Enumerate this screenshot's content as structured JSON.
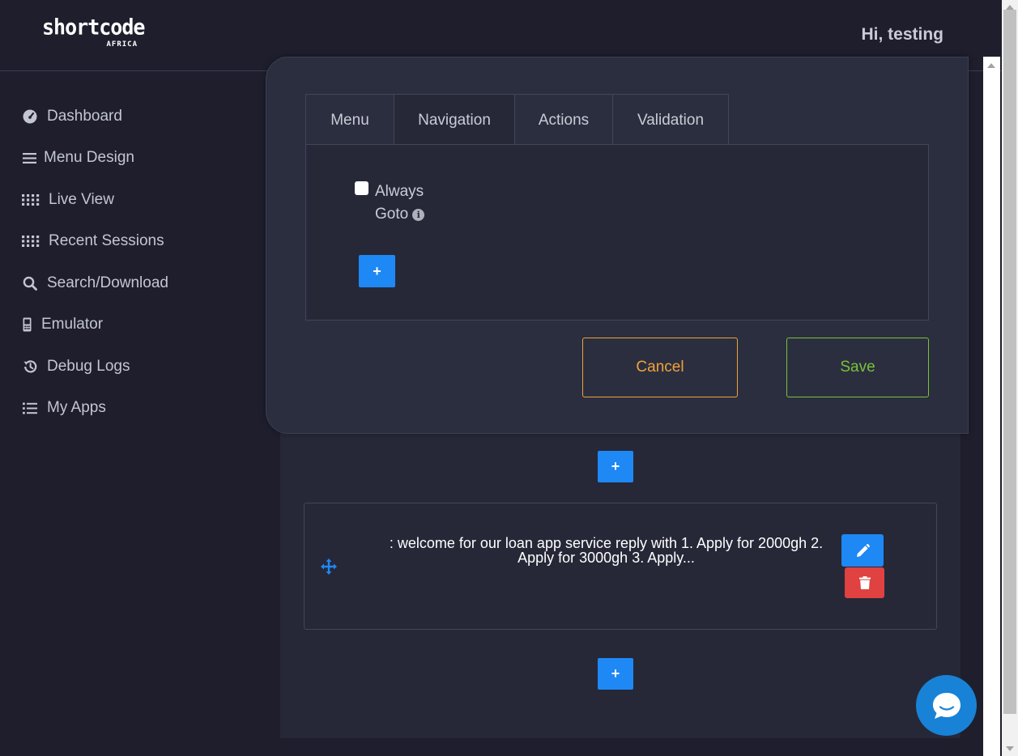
{
  "brand": {
    "logo_main": "shortcode",
    "logo_sub": "AFRICA"
  },
  "header": {
    "greeting": "Hi, testing"
  },
  "sidebar": {
    "items": [
      {
        "label": "Dashboard",
        "icon": "dashboard-icon"
      },
      {
        "label": "Menu Design",
        "icon": "bars-icon"
      },
      {
        "label": "Live View",
        "icon": "grid-dots-icon"
      },
      {
        "label": "Recent Sessions",
        "icon": "grid-dots-icon"
      },
      {
        "label": "Search/Download",
        "icon": "search-icon"
      },
      {
        "label": "Emulator",
        "icon": "mobile-phone-icon"
      },
      {
        "label": "Debug Logs",
        "icon": "history-icon"
      },
      {
        "label": "My Apps",
        "icon": "list-icon"
      }
    ]
  },
  "modal": {
    "tabs": [
      {
        "label": "Menu",
        "active": false
      },
      {
        "label": "Navigation",
        "active": true
      },
      {
        "label": "Actions",
        "active": false
      },
      {
        "label": "Validation",
        "active": false
      }
    ],
    "always_goto": {
      "line1": "Always",
      "line2": "Goto",
      "checked": false,
      "info_glyph": "i"
    },
    "add_label": "+",
    "cancel_label": "Cancel",
    "save_label": "Save"
  },
  "content": {
    "add_label": "+",
    "menu_item_text": ": welcome for our loan app service reply with 1. Apply for 2000gh 2. Apply for 3000gh 3. Apply..."
  },
  "colors": {
    "accent_blue": "#1e88f5",
    "danger_red": "#e04141",
    "cancel_orange": "#f0a23a",
    "save_green": "#7ac13a",
    "chat_blue": "#1882d6"
  }
}
